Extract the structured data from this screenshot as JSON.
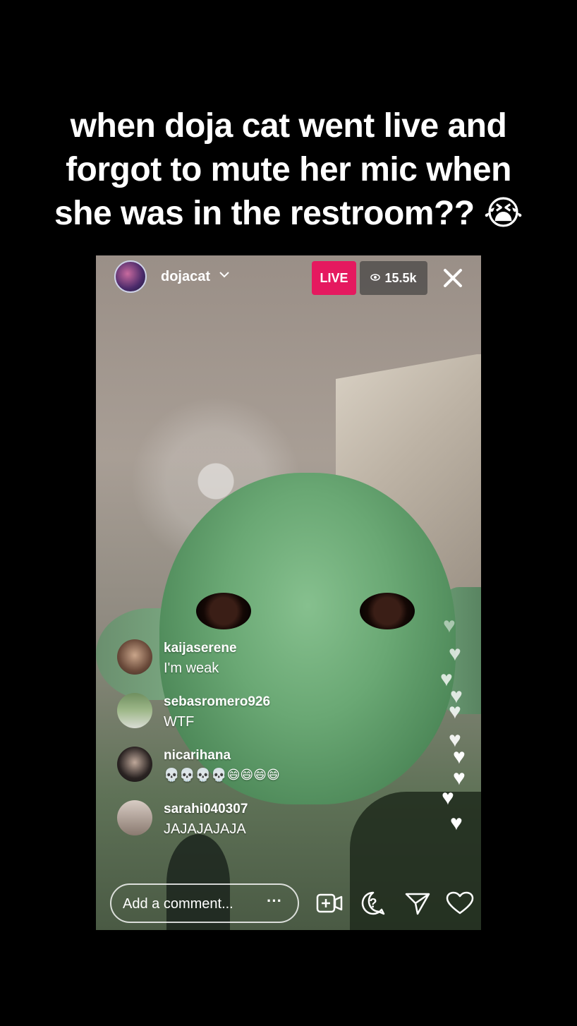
{
  "caption": {
    "line1": "when doja cat went live and",
    "line2": "forgot to mute her mic when",
    "line3": "she was in the restroom?? 😭"
  },
  "live": {
    "username": "dojacat",
    "live_label": "LIVE",
    "viewer_count": "15.5k"
  },
  "comments": [
    {
      "user": "kaijaserene",
      "text": "I'm weak"
    },
    {
      "user": "sebasromero926",
      "text": "WTF"
    },
    {
      "user": "nicarihana",
      "text": "💀💀💀💀😄😄😄😄"
    },
    {
      "user": "sarahi040307",
      "text": "JAJAJAJAJA"
    }
  ],
  "bottom_bar": {
    "comment_placeholder": "Add a comment...",
    "more_label": "···"
  },
  "icons": [
    "chevron-down-icon",
    "eye-icon",
    "close-icon",
    "more-icon",
    "add-video-icon",
    "question-icon",
    "send-icon",
    "heart-icon"
  ],
  "colors": {
    "live_badge": "#e5195f"
  }
}
